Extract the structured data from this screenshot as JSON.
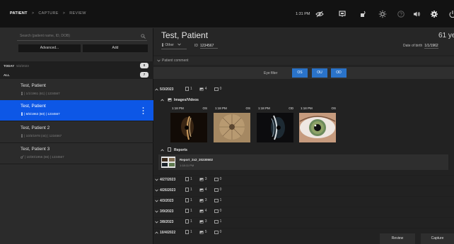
{
  "breadcrumb": [
    "PATIENT",
    "CAPTURE",
    "REVIEW"
  ],
  "breadcrumb_sep": ">",
  "topbar": {
    "time": "1:31 PM"
  },
  "colors": {
    "accent": "#0d57e6",
    "eye_button": "#2a73c9",
    "background": "#1b1b1b"
  },
  "icons": [
    "eye-slash-icon",
    "monitor-icon",
    "sensor-icon",
    "brightness-icon",
    "help-icon",
    "volume-icon",
    "settings-icon",
    "power-icon"
  ],
  "sidebar": {
    "search_placeholder": "Search (patient name, ID, DOB)",
    "advanced_label": "Advanced...",
    "add_label": "Add",
    "today_label": "TODAY",
    "today_date": "5/3/2023",
    "today_count": "0",
    "all_label": "ALL",
    "all_count": "7",
    "patients": [
      {
        "name": "Test, Patient",
        "meta": "1/1/1961 (61) | 1234567"
      },
      {
        "name": "Test, Patient",
        "meta": "6/5/1963 (60) | 1234567"
      },
      {
        "name": "Test, Patient 2",
        "meta": "10/3/1978 (44) | 1234567"
      },
      {
        "name": "Test, Patient 3",
        "meta": "10/30/1956 (66) | 1234567"
      }
    ]
  },
  "main": {
    "patient_name": "Test, Patient",
    "age": "61 ye",
    "gender": "Other",
    "id_label": "ID",
    "id_value": "1234567",
    "dob_label": "Date of birth",
    "dob_value": "1/1/1962",
    "comment_label": "Patient comment",
    "eye_filter_label": "Eye filter",
    "eye_buttons": [
      "OS",
      "OU",
      "OD"
    ],
    "visits": [
      {
        "date": "5/3/2023",
        "reports": "1",
        "images": "4",
        "videos": "0"
      },
      {
        "date": "4/27/2023",
        "reports": "1",
        "images": "3",
        "videos": "0"
      },
      {
        "date": "4/26/2023",
        "reports": "1",
        "images": "4",
        "videos": "0"
      },
      {
        "date": "4/3/2023",
        "reports": "1",
        "images": "3",
        "videos": "1"
      },
      {
        "date": "3/9/2023",
        "reports": "1",
        "images": "4",
        "videos": "0"
      },
      {
        "date": "3/8/2023",
        "reports": "1",
        "images": "3",
        "videos": "1"
      },
      {
        "date": "10/4/2022",
        "reports": "1",
        "images": "5",
        "videos": "0"
      }
    ],
    "images_label": "Images/Videos",
    "thumbs": [
      {
        "time": "1:18 PM",
        "eye": "OS"
      },
      {
        "time": "1:18 PM",
        "eye": "OS"
      },
      {
        "time": "1:18 PM",
        "eye": "OD"
      },
      {
        "time": "1:18 PM",
        "eye": "OS"
      }
    ],
    "reports_label": "Reports",
    "report": {
      "name": "Report_2x2_20230502",
      "time": "1:18:11 PM"
    },
    "review_label": "Review",
    "capture_label": "Capture"
  }
}
